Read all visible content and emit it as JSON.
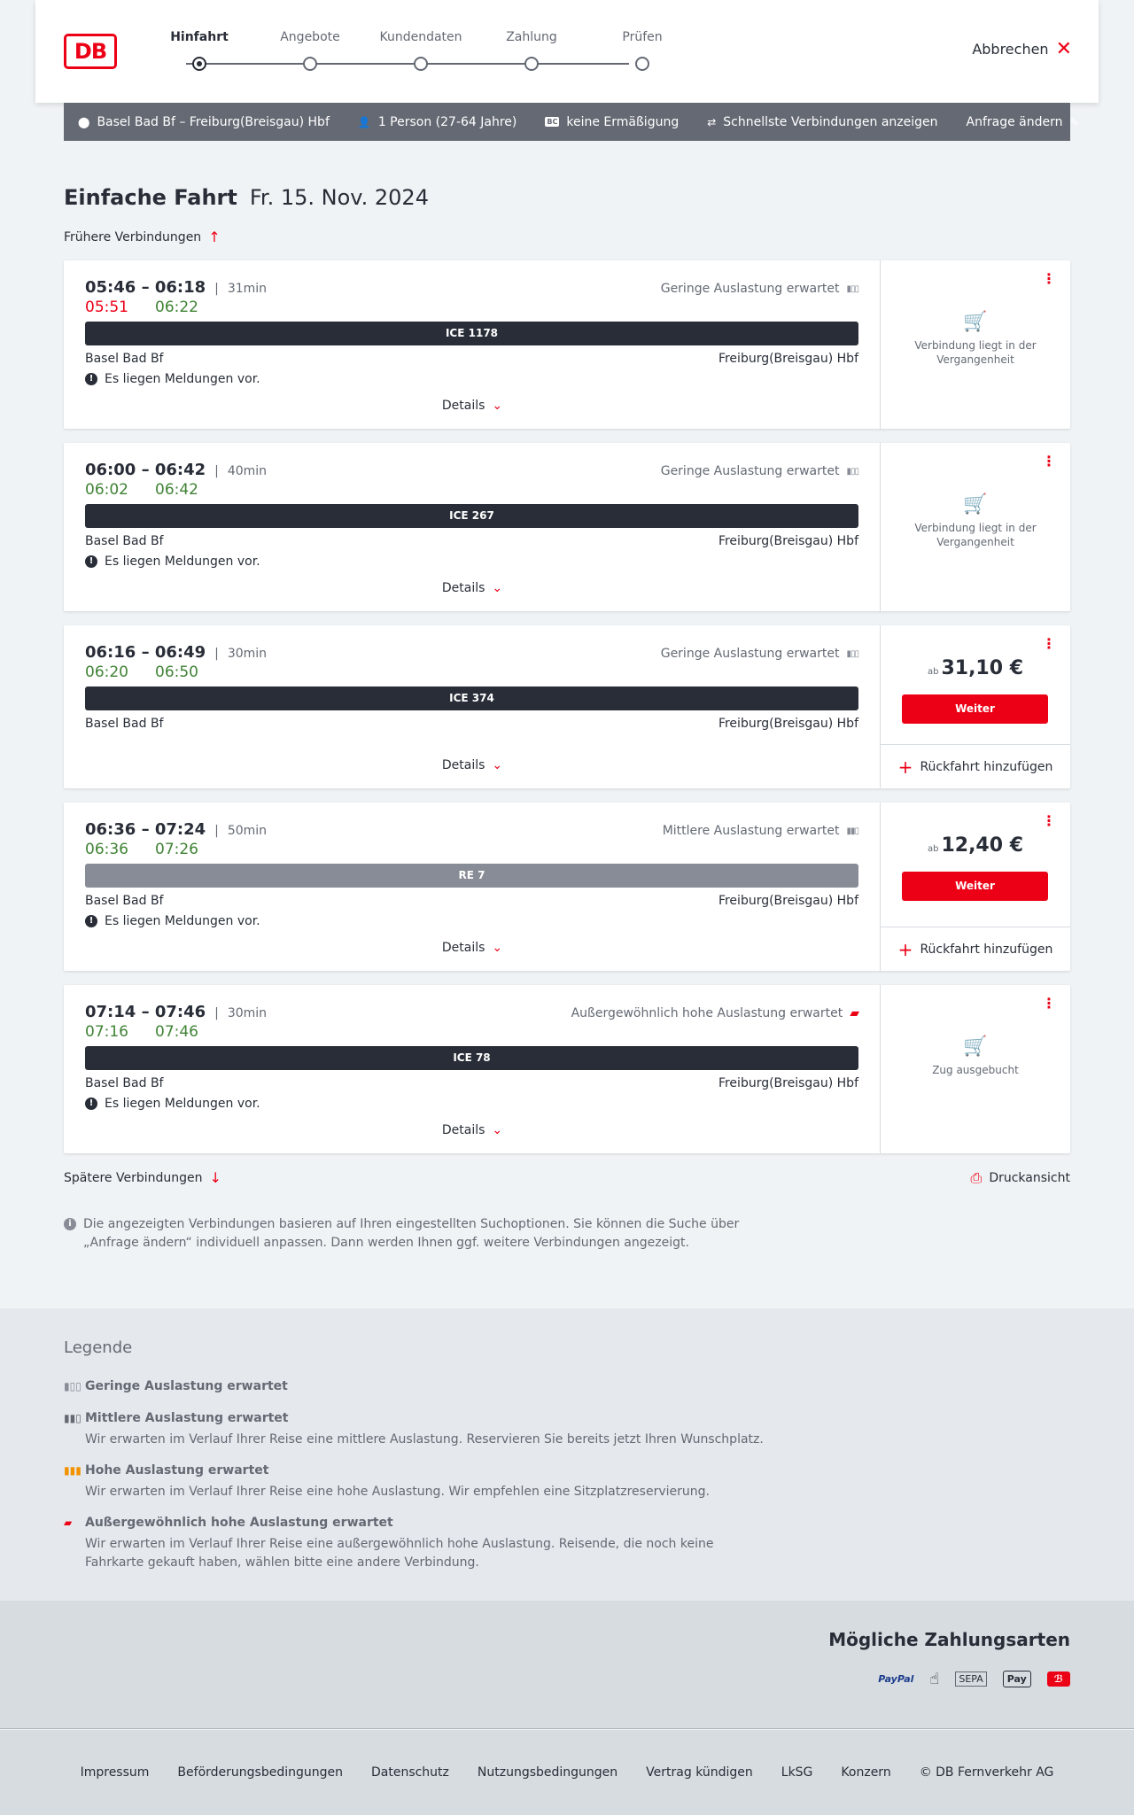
{
  "header": {
    "logo_text": "DB",
    "steps": [
      "Hinfahrt",
      "Angebote",
      "Kundendaten",
      "Zahlung",
      "Prüfen"
    ],
    "cancel_label": "Abbrechen"
  },
  "summary": {
    "route": "Basel Bad Bf – Freiburg(Breisgau) Hbf",
    "persons": "1 Person (27-64 Jahre)",
    "bc_badge": "BC",
    "discount": "keine Ermäßigung",
    "fastest": "Schnellste Verbindungen anzeigen",
    "change": "Anfrage ändern"
  },
  "page": {
    "title": "Einfache Fahrt",
    "date": "Fr. 15. Nov. 2024",
    "earlier": "Frühere Verbindungen",
    "later": "Spätere Verbindungen",
    "print": "Druckansicht",
    "info": "Die angezeigten Verbindungen basieren auf Ihren eingestellten Suchoptionen. Sie können die Suche über „Anfrage ändern“ individuell anpassen. Dann werden Ihnen ggf. weitere Verbindungen angezeigt."
  },
  "connections": [
    {
      "times": "05:46 – 06:18",
      "duration": "31min",
      "rt_dep": "05:51",
      "rt_arr": "06:22",
      "load": "Geringe Auslastung erwartet",
      "train": "ICE 1178",
      "from": "Basel Bad Bf",
      "to": "Freiburg(Breisgau) Hbf",
      "message": "Es liegen Meldungen vor.",
      "details": "Details",
      "status": "Verbindung liegt in der Vergangenheit"
    },
    {
      "times": "06:00 – 06:42",
      "duration": "40min",
      "rt_dep": "06:02",
      "rt_arr": "06:42",
      "load": "Geringe Auslastung erwartet",
      "train": "ICE 267",
      "from": "Basel Bad Bf",
      "to": "Freiburg(Breisgau) Hbf",
      "message": "Es liegen Meldungen vor.",
      "details": "Details",
      "status": "Verbindung liegt in der Vergangenheit"
    },
    {
      "times": "06:16 – 06:49",
      "duration": "30min",
      "rt_dep": "06:20",
      "rt_arr": "06:50",
      "load": "Geringe Auslastung erwartet",
      "train": "ICE 374",
      "from": "Basel Bad Bf",
      "to": "Freiburg(Breisgau) Hbf",
      "details": "Details",
      "price_prefix": "ab",
      "price": "31,10 €",
      "button": "Weiter",
      "return": "Rückfahrt hinzufügen"
    },
    {
      "times": "06:36 – 07:24",
      "duration": "50min",
      "rt_dep": "06:36",
      "rt_arr": "07:26",
      "load": "Mittlere Auslastung erwartet",
      "train": "RE 7",
      "from": "Basel Bad Bf",
      "to": "Freiburg(Breisgau) Hbf",
      "message": "Es liegen Meldungen vor.",
      "details": "Details",
      "price_prefix": "ab",
      "price": "12,40 €",
      "button": "Weiter",
      "return": "Rückfahrt hinzufügen"
    },
    {
      "times": "07:14 – 07:46",
      "duration": "30min",
      "rt_dep": "07:16",
      "rt_arr": "07:46",
      "load": "Außergewöhnlich hohe Auslastung erwartet",
      "train": "ICE 78",
      "from": "Basel Bad Bf",
      "to": "Freiburg(Breisgau) Hbf",
      "message": "Es liegen Meldungen vor.",
      "details": "Details",
      "status": "Zug ausgebucht"
    }
  ],
  "legend": {
    "title": "Legende",
    "items": [
      {
        "head": "Geringe Auslastung erwartet",
        "desc": "",
        "color": "#878c96"
      },
      {
        "head": "Mittlere Auslastung erwartet",
        "desc": "Wir erwarten im Verlauf Ihrer Reise eine mittlere Auslastung. Reservieren Sie bereits jetzt Ihren Wunschplatz.",
        "color": "#646973"
      },
      {
        "head": "Hohe Auslastung erwartet",
        "desc": "Wir erwarten im Verlauf Ihrer Reise eine hohe Auslastung. Wir empfehlen eine Sitzplatzreservierung.",
        "color": "#f39200"
      },
      {
        "head": "Außergewöhnlich hohe Auslastung erwartet",
        "desc": "Wir erwarten im Verlauf Ihrer Reise eine außergewöhnlich hohe Auslastung. Reisende, die noch keine Fahrkarte gekauft haben, wählen bitte eine andere Verbindung.",
        "color": "#ec0016"
      }
    ]
  },
  "payment": {
    "title": "Mögliche Zahlungsarten",
    "paypal": "PayPal",
    "sepa": "SEPA",
    "applepay": "Pay"
  },
  "footer": [
    "Impressum",
    "Beförderungsbedingungen",
    "Datenschutz",
    "Nutzungsbedingungen",
    "Vertrag kündigen",
    "LkSG",
    "Konzern",
    "© DB Fernverkehr AG"
  ]
}
